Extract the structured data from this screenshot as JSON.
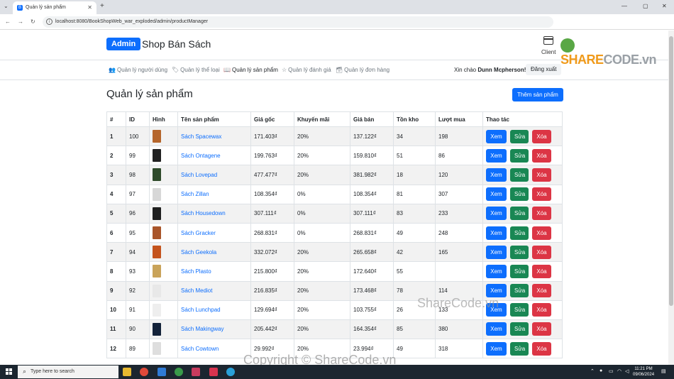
{
  "browser": {
    "tab_title": "Quản lý sản phẩm",
    "url": "localhost:8080/BookShopWeb_war_exploded/admin/productManager"
  },
  "header": {
    "brand_badge": "Admin",
    "brand_title": "Shop Bán Sách",
    "client_label": "Client"
  },
  "nav": {
    "items": [
      {
        "label": "Quản lý người dùng",
        "icon": "users-icon"
      },
      {
        "label": "Quản lý thể loại",
        "icon": "tag-icon"
      },
      {
        "label": "Quản lý sản phẩm",
        "icon": "book-icon"
      },
      {
        "label": "Quản lý đánh giá",
        "icon": "star-icon"
      },
      {
        "label": "Quản lý đơn hàng",
        "icon": "inbox-icon"
      }
    ],
    "greeting": "Xin chào",
    "user": "Dunn Mcpherson!",
    "logout": "Đăng xuất"
  },
  "main": {
    "title": "Quản lý sản phẩm",
    "add_button": "Thêm sản phẩm"
  },
  "table": {
    "headers": [
      "#",
      "ID",
      "Hình",
      "Tên sản phẩm",
      "Giá gốc",
      "Khuyến mãi",
      "Giá bán",
      "Tồn kho",
      "Lượt mua",
      "Thao tác"
    ],
    "actions": {
      "view": "Xem",
      "edit": "Sửa",
      "delete": "Xóa"
    },
    "rows": [
      {
        "stt": "1",
        "id": "100",
        "name": "Sách Spacewax",
        "price": "171.403₫",
        "discount": "20%",
        "sale": "137.122₫",
        "stock": "34",
        "sold": "198",
        "cover": "#b5652b"
      },
      {
        "stt": "2",
        "id": "99",
        "name": "Sách Ontagene",
        "price": "199.763₫",
        "discount": "20%",
        "sale": "159.810₫",
        "stock": "51",
        "sold": "86",
        "cover": "#222222"
      },
      {
        "stt": "3",
        "id": "98",
        "name": "Sách Lovepad",
        "price": "477.477₫",
        "discount": "20%",
        "sale": "381.982₫",
        "stock": "18",
        "sold": "120",
        "cover": "#2e4a2a"
      },
      {
        "stt": "4",
        "id": "97",
        "name": "Sách Zillan",
        "price": "108.354₫",
        "discount": "0%",
        "sale": "108.354₫",
        "stock": "81",
        "sold": "307",
        "cover": "#d7d7d7"
      },
      {
        "stt": "5",
        "id": "96",
        "name": "Sách Housedown",
        "price": "307.111₫",
        "discount": "0%",
        "sale": "307.111₫",
        "stock": "83",
        "sold": "233",
        "cover": "#1f1f1f"
      },
      {
        "stt": "6",
        "id": "95",
        "name": "Sách Gracker",
        "price": "268.831₫",
        "discount": "0%",
        "sale": "268.831₫",
        "stock": "49",
        "sold": "248",
        "cover": "#a9552a"
      },
      {
        "stt": "7",
        "id": "94",
        "name": "Sách Geekola",
        "price": "332.072₫",
        "discount": "20%",
        "sale": "265.658₫",
        "stock": "42",
        "sold": "165",
        "cover": "#c4531c"
      },
      {
        "stt": "8",
        "id": "93",
        "name": "Sách Plasto",
        "price": "215.800₫",
        "discount": "20%",
        "sale": "172.640₫",
        "stock": "55",
        "sold": "",
        "cover": "#c9a35a"
      },
      {
        "stt": "9",
        "id": "92",
        "name": "Sách Mediot",
        "price": "216.835₫",
        "discount": "20%",
        "sale": "173.468₫",
        "stock": "78",
        "sold": "114",
        "cover": "#e8e8e8"
      },
      {
        "stt": "10",
        "id": "91",
        "name": "Sách Lunchpad",
        "price": "129.694₫",
        "discount": "20%",
        "sale": "103.755₫",
        "stock": "26",
        "sold": "133",
        "cover": "#eeeeee"
      },
      {
        "stt": "11",
        "id": "90",
        "name": "Sách Makingway",
        "price": "205.442₫",
        "discount": "20%",
        "sale": "164.354₫",
        "stock": "85",
        "sold": "380",
        "cover": "#14233a"
      },
      {
        "stt": "12",
        "id": "89",
        "name": "Sách Cowtown",
        "price": "29.992₫",
        "discount": "20%",
        "sale": "23.994₫",
        "stock": "49",
        "sold": "318",
        "cover": "#dedede"
      }
    ]
  },
  "watermarks": {
    "logo_brand": "SHARE",
    "logo_rest": "CODE.vn",
    "center": "ShareCode.vn",
    "bottom": "Copyright © ShareCode.vn"
  },
  "taskbar": {
    "search_placeholder": "Type here to search",
    "time": "11:21 PM",
    "date": "09/06/2024"
  }
}
